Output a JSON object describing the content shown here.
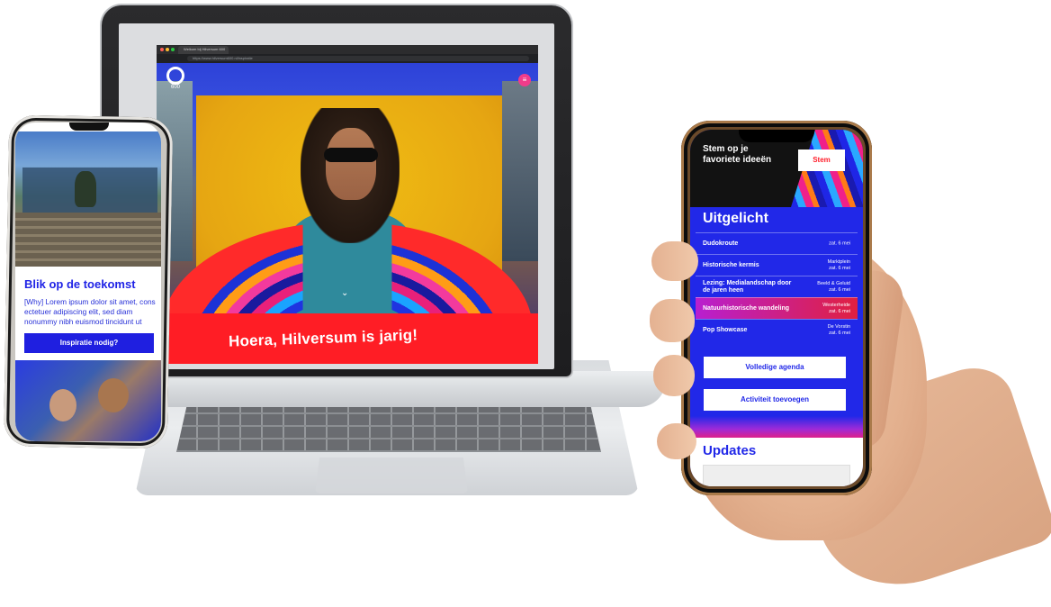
{
  "laptop": {
    "browser": {
      "tab_title": "Welkom bij Hilversum 600",
      "url": "https://www.hilversum600.nl/inspiratie"
    },
    "hero": {
      "logo_text": "600",
      "headline": "Hoera, Hilversum is jarig!",
      "chevron": "⌄",
      "menu_icon": "≡"
    }
  },
  "phone_left": {
    "heading": "Blik op de toekomst",
    "body": "[Why] Lorem ipsum dolor sit amet, cons ectetuer adipiscing elit, sed diam nonummy nibh euismod tincidunt ut",
    "button": "Inspiratie nodig?"
  },
  "phone_right": {
    "vote_banner": {
      "text": "Stem op je favoriete ideeën",
      "button": "Stem"
    },
    "featured": {
      "title": "Uitgelicht",
      "items": [
        {
          "title": "Dudokroute",
          "location": "",
          "date": "zat. 6 mei",
          "highlight": false
        },
        {
          "title": "Historische kermis",
          "location": "Marktplein",
          "date": "zat. 6 mei",
          "highlight": false
        },
        {
          "title": "Lezing: Medialandschap door de jaren heen",
          "location": "Beeld & Geluid",
          "date": "zat. 6 mei",
          "highlight": false
        },
        {
          "title": "Natuurhistorische wandeling",
          "location": "Westerheide",
          "date": "zat. 6 mei",
          "highlight": true
        },
        {
          "title": "Pop Showcase",
          "location": "De Vorstin",
          "date": "zat. 6 mei",
          "highlight": false
        }
      ]
    },
    "buttons": {
      "full_agenda": "Volledige agenda",
      "add_activity": "Activiteit toevoegen"
    },
    "updates_title": "Updates"
  }
}
